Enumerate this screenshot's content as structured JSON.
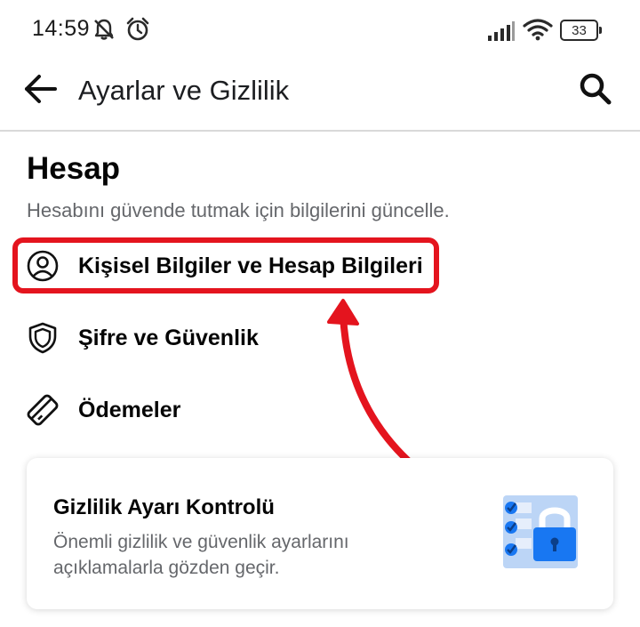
{
  "status_bar": {
    "time": "14:59",
    "battery": "33",
    "icons": [
      "mute-notification-icon",
      "alarm-icon",
      "signal-icon",
      "wifi-icon",
      "battery-icon"
    ]
  },
  "header": {
    "title": "Ayarlar ve Gizlilik",
    "back_icon": "back-arrow-icon",
    "search_icon": "search-icon"
  },
  "section": {
    "title": "Hesap",
    "subtitle": "Hesabını güvende tutmak için bilgilerini güncelle."
  },
  "menu": [
    {
      "label": "Kişisel Bilgiler ve Hesap Bilgileri",
      "icon": "person-circle-icon",
      "highlighted": true
    },
    {
      "label": "Şifre ve Güvenlik",
      "icon": "shield-icon"
    },
    {
      "label": "Ödemeler",
      "icon": "payment-card-icon"
    }
  ],
  "card": {
    "title": "Gizlilik Ayarı Kontrolü",
    "description": "Önemli gizlilik ve güvenlik ayarlarını açıklamalarla gözden geçir.",
    "illustration": "privacy-checklist-lock-icon"
  },
  "colors": {
    "highlight": "#e4141e",
    "brand_blue": "#1877f2",
    "text_primary": "#050505",
    "text_secondary": "#65676b",
    "divider": "#d9d9d9"
  }
}
